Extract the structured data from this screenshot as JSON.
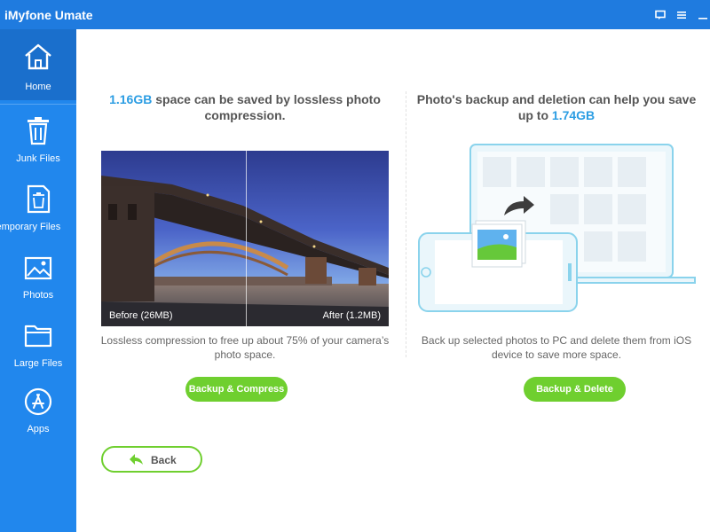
{
  "app": {
    "title": "iMyfone Umate"
  },
  "titlebar": {
    "icons": [
      "feedback-icon",
      "menu-icon",
      "minimize-icon"
    ]
  },
  "sidebar": {
    "items": [
      {
        "label": "Home",
        "icon": "home-icon",
        "active": true
      },
      {
        "label": "Junk Files",
        "icon": "trash-icon",
        "active": false
      },
      {
        "label": "Temporary Files",
        "icon": "temp-files-icon",
        "active": false
      },
      {
        "label": "Photos",
        "icon": "photos-icon",
        "active": false
      },
      {
        "label": "Large Files",
        "icon": "folder-icon",
        "active": false
      },
      {
        "label": "Apps",
        "icon": "apps-icon",
        "active": false
      }
    ]
  },
  "left_panel": {
    "headline_highlight": "1.16GB",
    "headline_rest_1": " space can be saved by lossless photo",
    "headline_line2": "compression.",
    "before_label": "Before (26MB)",
    "after_label": "After (1.2MB)",
    "caption_line1": "Lossless compression to free up about 75% of your camera’s",
    "caption_line2": "photo space.",
    "button_label": "Backup & Compress"
  },
  "right_panel": {
    "headline_line1": "Photo's backup and deletion can help you save",
    "headline_line2_prefix": "up to ",
    "headline_highlight": "1.74GB",
    "caption_line1": "Back up selected photos to PC and delete them from iOS",
    "caption_line2": "device to save more space.",
    "button_label": "Backup & Delete"
  },
  "back_button": {
    "label": "Back"
  },
  "colors": {
    "titlebar": "#1f7bdf",
    "sidebar": "#2187ed",
    "sidebar_active": "#1a6fcc",
    "highlight": "#2b9de3",
    "button_green": "#6fcf2f"
  }
}
